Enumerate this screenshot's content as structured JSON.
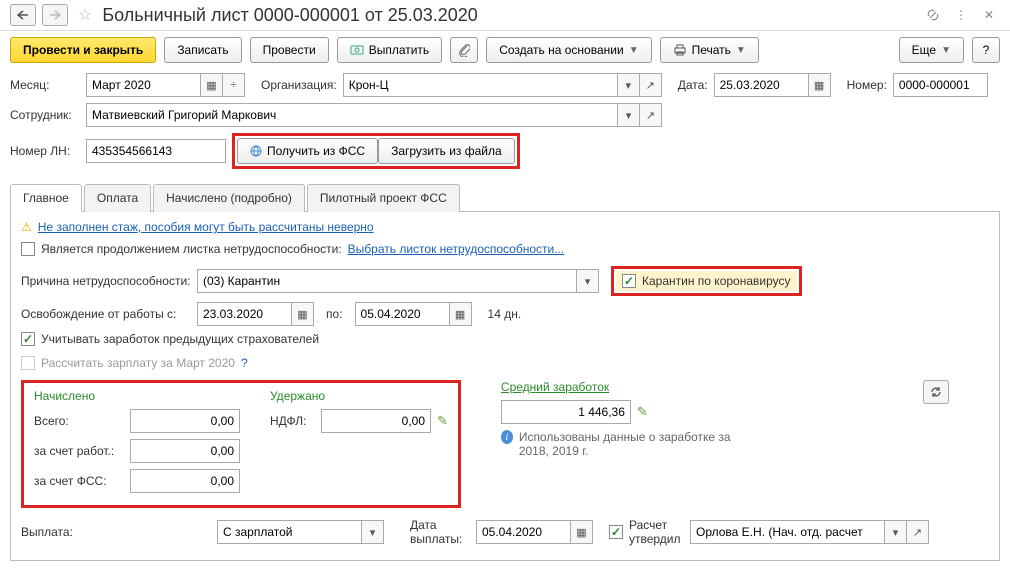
{
  "header": {
    "title": "Больничный лист 0000-000001 от 25.03.2020"
  },
  "actions": {
    "submit_close": "Провести и закрыть",
    "save": "Записать",
    "post": "Провести",
    "pay": "Выплатить",
    "create_based": "Создать на основании",
    "print": "Печать",
    "more": "Еще",
    "help": "?"
  },
  "fields": {
    "month_label": "Месяц:",
    "month_value": "Март 2020",
    "org_label": "Организация:",
    "org_value": "Крон-Ц",
    "date_label": "Дата:",
    "date_value": "25.03.2020",
    "number_label": "Номер:",
    "number_value": "0000-000001",
    "employee_label": "Сотрудник:",
    "employee_value": "Матвиевский Григорий Маркович",
    "ln_label": "Номер ЛН:",
    "ln_value": "435354566143",
    "get_fss": "Получить из ФСС",
    "load_file": "Загрузить из файла"
  },
  "tabs": {
    "main": "Главное",
    "payment": "Оплата",
    "accrued_detail": "Начислено (подробно)",
    "pilot": "Пилотный проект ФСС"
  },
  "main_panel": {
    "warn_link": "Не заполнен стаж, пособия могут быть рассчитаны неверно",
    "continuation_label": "Является продолжением листка нетрудоспособности:",
    "choose_sheet": "Выбрать листок нетрудоспособности...",
    "cause_label": "Причина нетрудоспособности:",
    "cause_value": "(03) Карантин",
    "covid_label": "Карантин по коронавирусу",
    "period_from_label": "Освобождение от работы с:",
    "period_from": "23.03.2020",
    "period_to_label": "по:",
    "period_to": "05.04.2020",
    "days": "14 дн.",
    "prev_insurers": "Учитывать заработок предыдущих страхователей",
    "calc_salary": "Рассчитать зарплату за Март 2020",
    "q": "?"
  },
  "calc": {
    "accrued_title": "Начислено",
    "withheld_title": "Удержано",
    "avg_title": "Средний заработок",
    "total_label": "Всего:",
    "total_value": "0,00",
    "employer_label": "за счет работ.:",
    "employer_value": "0,00",
    "fss_label": "за счет ФСС:",
    "fss_value": "0,00",
    "ndfl_label": "НДФЛ:",
    "ndfl_value": "0,00",
    "avg_value": "1 446,36",
    "info_text": "Использованы данные о заработке за 2018,   2019 г."
  },
  "footer": {
    "payout_label": "Выплата:",
    "payout_value": "С зарплатой",
    "paydate_label": "Дата выплаты:",
    "paydate_value": "05.04.2020",
    "approved_label": "Расчет утвердил",
    "approver": "Орлова Е.Н. (Нач. отд. расчет"
  }
}
